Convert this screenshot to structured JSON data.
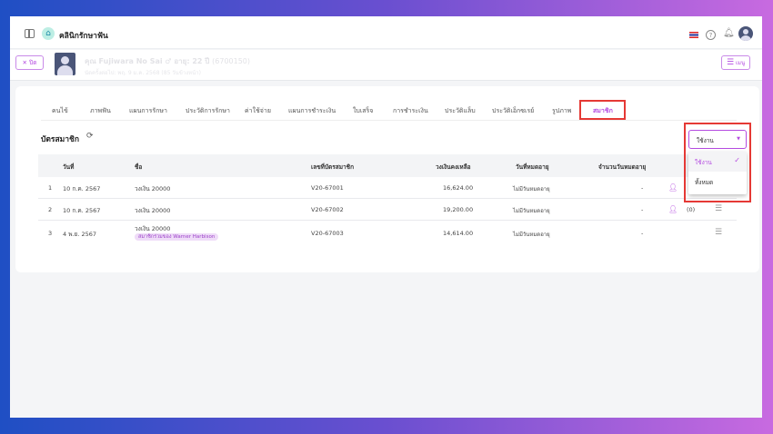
{
  "app": {
    "title": "คลินิกรักษาฟัน"
  },
  "patient": {
    "close_label": "ปิด",
    "name": "คุณ Fujiwara No Sai",
    "gender_symbol": "♂",
    "age": "อายุ: 22 ปี",
    "id": "(6700150)",
    "next_appt": "นัดครั้งต่อไป: พฤ. 9 ม.ค. 2568 (85 วันข้างหน้า)",
    "menu_label": "เมนู"
  },
  "tabs": [
    "คนไข้",
    "ภาพฟัน",
    "แผนการรักษา",
    "ประวัติการรักษา",
    "ค่าใช้จ่าย",
    "แผนการชำระเงิน",
    "ใบเสร็จ",
    "การชำระเงิน",
    "ประวัติแล็บ",
    "ประวัติเอ็กซเรย์",
    "รูปภาพ",
    "สมาชิก"
  ],
  "active_tab": "สมาชิก",
  "section": {
    "title": "บัตรสมาชิก"
  },
  "filter": {
    "selected": "ใช้งาน",
    "options": [
      "ใช้งาน",
      "ทั้งหมด"
    ]
  },
  "table": {
    "headers": [
      "วันที่",
      "ชื่อ",
      "เลขที่บัตรสมาชิก",
      "วงเงินคงเหลือ",
      "วันที่หมดอายุ",
      "จำนวนวันหมดอายุ"
    ],
    "rows": [
      {
        "no": "1",
        "date": "10 ก.ค. 2567",
        "name": "วงเงิน 20000",
        "tag": "",
        "card": "V20-67001",
        "balance": "16,624.00",
        "expiry": "ไม่มีวันหมดอายุ",
        "days": "-",
        "share": ""
      },
      {
        "no": "2",
        "date": "10 ก.ค. 2567",
        "name": "วงเงิน 20000",
        "tag": "",
        "card": "V20-67002",
        "balance": "19,200.00",
        "expiry": "ไม่มีวันหมดอายุ",
        "days": "-",
        "share": "(0)"
      },
      {
        "no": "3",
        "date": "4 พ.ย. 2567",
        "name": "วงเงิน 20000",
        "tag": "สมาชิกร่วมของ Warner Harbison",
        "card": "V20-67003",
        "balance": "14,614.00",
        "expiry": "ไม่มีวันหมดอายุ",
        "days": "-",
        "share": ""
      }
    ]
  },
  "colors": {
    "accent": "#b44be0",
    "highlight": "#e53935"
  }
}
